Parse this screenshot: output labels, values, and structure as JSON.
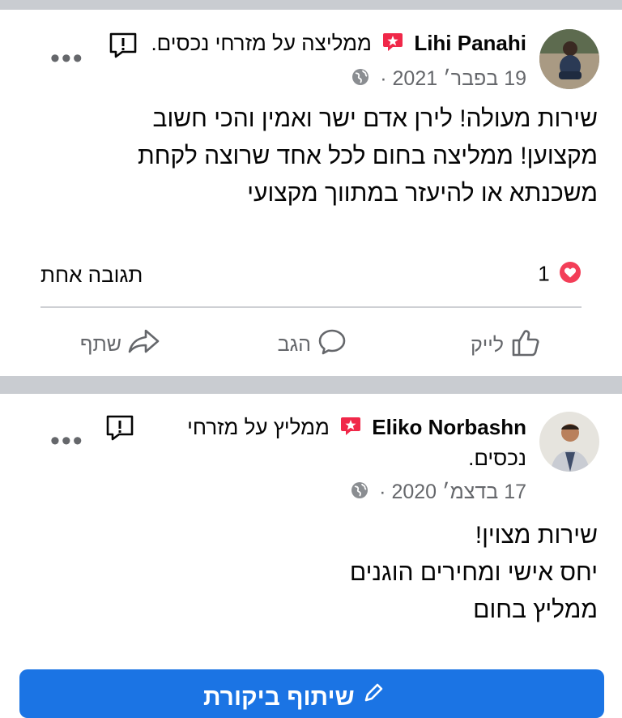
{
  "reviews": [
    {
      "author": "Lihi Panahi",
      "recommend_text": "ממליצה על מזרחי נכסים.",
      "recommend_text_line2": "",
      "date": "19 בפבר׳ 2021",
      "body": [
        "שירות מעולה! לירן אדם ישר ואמין והכי חשוב",
        "מקצוען! ממליצה בחום לכל אחד שרוצה לקחת",
        "משכנתא או להיעזר במתווך מקצועי"
      ],
      "reactions_count": "1",
      "comments_label": "תגובה אחת",
      "actions": {
        "like": "לייק",
        "comment": "הגב",
        "share": "שתף"
      }
    },
    {
      "author": "Eliko Norbashn",
      "recommend_text": "ממליץ על מזרחי",
      "recommend_text_line2": "נכסים.",
      "date": "17 בדצמ׳ 2020",
      "body": [
        "שירות מצוין!",
        "יחס אישי ומחירים הוגנים",
        "ממליץ בחום"
      ]
    }
  ],
  "cta": {
    "label": "שיתוף ביקורת"
  },
  "colors": {
    "accent": "#1b74e4",
    "recommend_badge": "#f02849",
    "heart": "#f33e58"
  },
  "icons": [
    "more-icon",
    "report-icon",
    "recommend-icon",
    "globe-icon",
    "heart-icon",
    "like-icon",
    "comment-icon",
    "share-icon",
    "edit-icon"
  ]
}
